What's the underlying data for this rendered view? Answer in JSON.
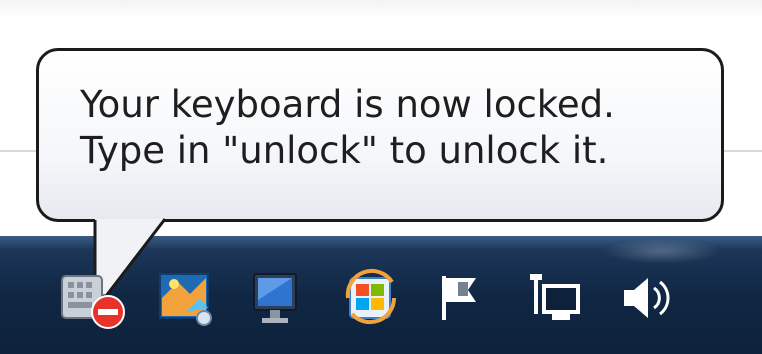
{
  "balloon": {
    "line1": "Your keyboard is now locked.",
    "line2": "Type in \"unlock\" to unlock it."
  },
  "tray": {
    "icons": [
      "keyboard-locked-icon",
      "photo-app-icon",
      "monitor-icon",
      "windows-update-icon",
      "action-center-flag-icon",
      "network-icon",
      "volume-icon"
    ]
  },
  "colors": {
    "taskbar": "#102744",
    "balloon_border": "#1b1b1b",
    "balloon_fill": "#ffffff",
    "lock_badge": "#e8332a"
  }
}
